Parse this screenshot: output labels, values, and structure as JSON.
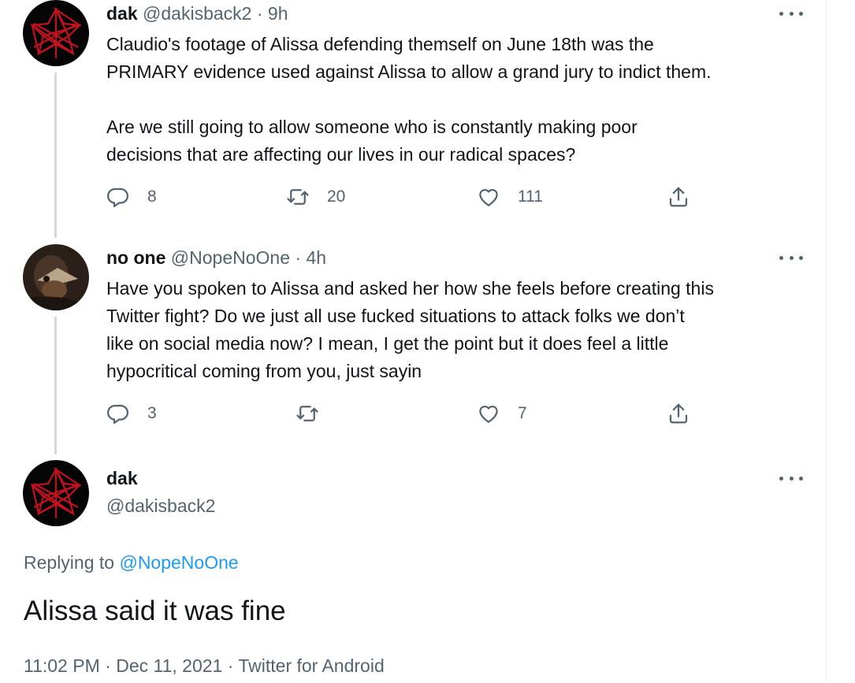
{
  "tweets": [
    {
      "name": "dak",
      "handle": "@dakisback2",
      "time": "9h",
      "text": "Claudio's footage of Alissa defending themself on June 18th was the\nPRIMARY evidence used against Alissa to allow a grand jury to indict them.\n\nAre we still going to allow someone who is constantly making poor\ndecisions that are affecting our lives in our radical spaces?",
      "replies": "8",
      "retweets": "20",
      "likes": "111"
    },
    {
      "name": "no one",
      "handle": "@NopeNoOne",
      "time": "4h",
      "text": "Have you spoken to Alissa and asked her how she feels before creating this\nTwitter fight? Do we just all use fucked situations to attack folks we don’t\nlike on social media now? I mean, I get the point but it does feel a little\nhypocritical coming from you, just sayin",
      "replies": "3",
      "retweets": "",
      "likes": "7"
    }
  ],
  "main": {
    "name": "dak",
    "handle": "@dakisback2",
    "replying_to_label": "Replying to",
    "replying_to_handle": "@NopeNoOne",
    "text": "Alissa said it was fine",
    "time": "11:02 PM",
    "date": "Dec 11, 2021",
    "source": "Twitter for Android"
  },
  "separator": "·",
  "icons": {
    "reply": "reply-icon",
    "retweet": "retweet-icon",
    "like": "heart-icon",
    "share": "share-icon",
    "more": "more-icon"
  },
  "colors": {
    "text": "#0f1419",
    "secondary": "#536471",
    "link": "#1d9bf0",
    "thread_line": "#cfd9de",
    "pentagram": "#c1121f"
  }
}
